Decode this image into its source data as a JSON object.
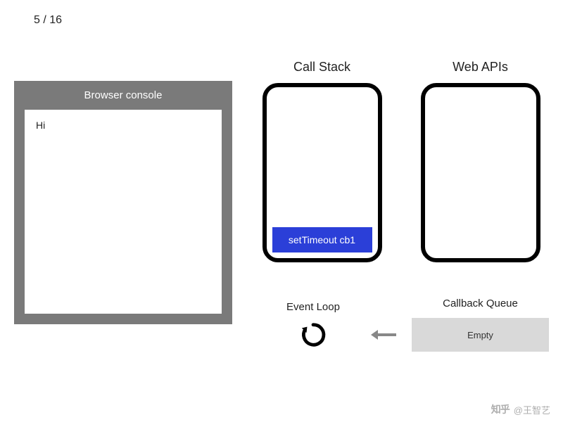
{
  "slide": {
    "current": 5,
    "total": 16,
    "separator": " / "
  },
  "console": {
    "title": "Browser console",
    "output": "Hi"
  },
  "callStack": {
    "title": "Call Stack",
    "items": [
      "setTimeout cb1"
    ]
  },
  "webApis": {
    "title": "Web APIs",
    "items": []
  },
  "eventLoop": {
    "title": "Event Loop"
  },
  "callbackQueue": {
    "title": "Callback Queue",
    "content": "Empty"
  },
  "watermark": {
    "brand": "知乎",
    "user": "@王智艺"
  }
}
